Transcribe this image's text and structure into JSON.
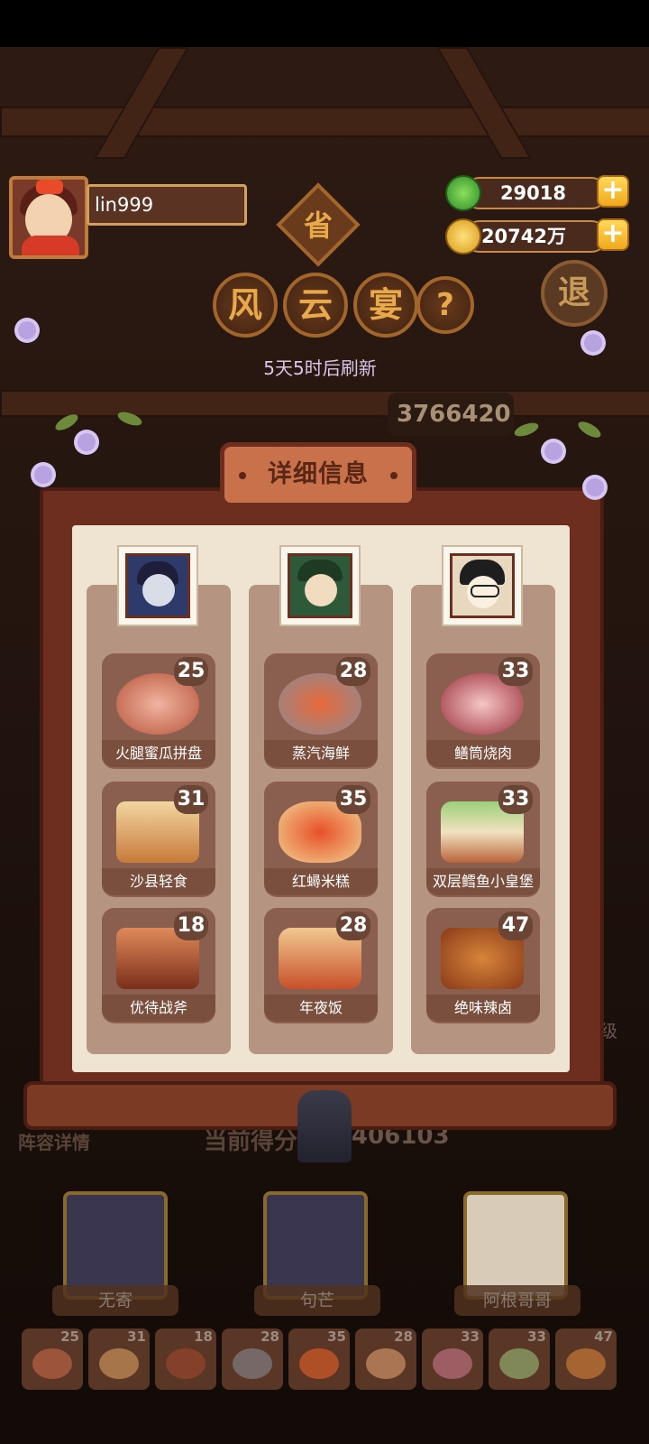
{
  "header": {
    "player_name": "lin999",
    "currency": [
      {
        "icon": "jade-icon",
        "value": "29018"
      },
      {
        "icon": "coin-icon",
        "value": "20742万"
      }
    ],
    "province_label": "省",
    "title_chars": [
      "风",
      "云",
      "宴"
    ],
    "help_label": "?",
    "retreat_label": "退",
    "refresh_text": "5天5时后刷新",
    "score_peek": "3766420"
  },
  "panel": {
    "title": "详细信息",
    "columns": [
      {
        "dishes": [
          {
            "name": "火腿蜜瓜拼盘",
            "level": "25"
          },
          {
            "name": "沙县轻食",
            "level": "31"
          },
          {
            "name": "优待战斧",
            "level": "18"
          }
        ]
      },
      {
        "dishes": [
          {
            "name": "蒸汽海鲜",
            "level": "28"
          },
          {
            "name": "红蟳米糕",
            "level": "35"
          },
          {
            "name": "年夜饭",
            "level": "28"
          }
        ]
      },
      {
        "dishes": [
          {
            "name": "鳝筒烧肉",
            "level": "33"
          },
          {
            "name": "双层鳕鱼小皇堡",
            "level": "33"
          },
          {
            "name": "绝味辣卤",
            "level": "47"
          }
        ]
      }
    ]
  },
  "background": {
    "lineup_label": "阵容详情",
    "current_score_label": "当前得分",
    "current_score_value": "406103",
    "side_label": "级",
    "characters": [
      "无寄",
      "句芒",
      "阿根哥哥"
    ],
    "dish_slots": [
      "25",
      "31",
      "18",
      "28",
      "35",
      "28",
      "33",
      "33",
      "47"
    ]
  },
  "colors": {
    "frame": "#6e2e1f",
    "paper": "#efe4d2",
    "accent": "#f0a91e"
  }
}
